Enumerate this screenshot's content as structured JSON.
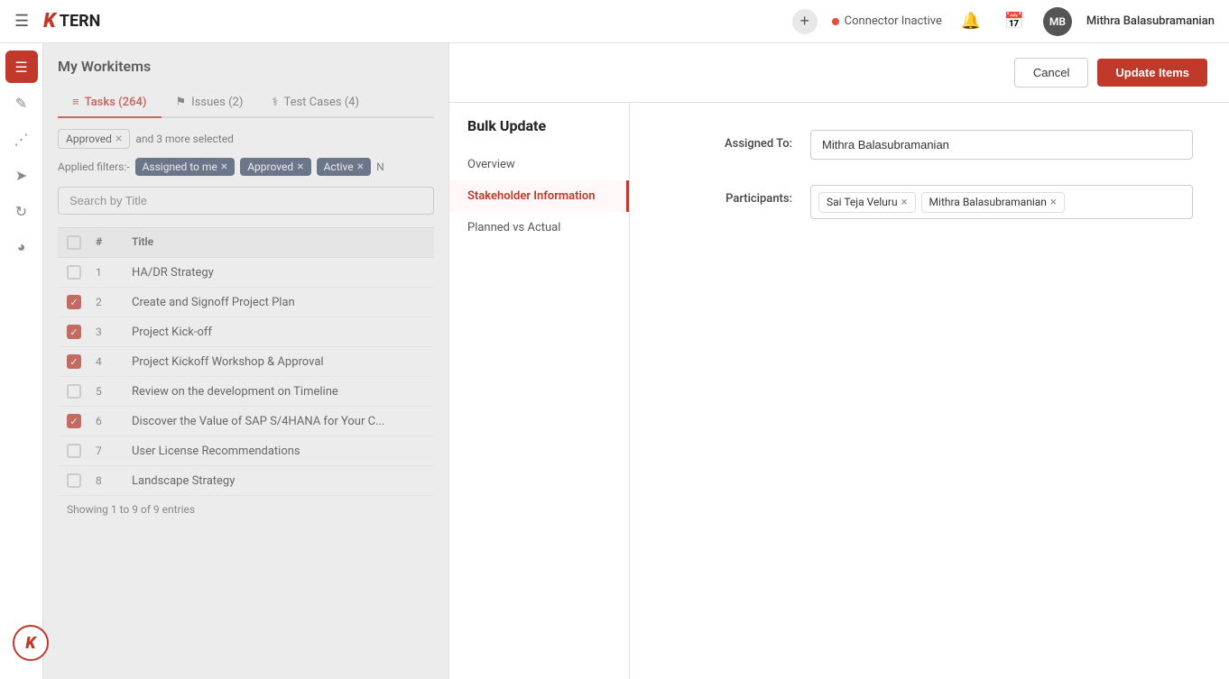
{
  "app": {
    "logo_k": "K",
    "logo_tern": "TERN"
  },
  "nav": {
    "connector_label": "Connector Inactive",
    "username": "Mithra Balasubramanian",
    "avatar_initials": "MB",
    "add_btn_label": "+"
  },
  "workitems": {
    "title": "My Workitems",
    "tabs": [
      {
        "id": "tasks",
        "icon": "≡",
        "label": "Tasks (264)",
        "active": true
      },
      {
        "id": "issues",
        "icon": "⚑",
        "label": "Issues (2)",
        "active": false
      },
      {
        "id": "testcases",
        "icon": "⚗",
        "label": "Test Cases (4)",
        "active": false
      }
    ],
    "selected_badges": [
      {
        "label": "Approved",
        "removable": true
      }
    ],
    "more_selected": "and 3 more selected",
    "filters_label": "Applied filters:-",
    "filters": [
      {
        "label": "Assigned to me",
        "removable": true
      },
      {
        "label": "Approved",
        "removable": true
      },
      {
        "label": "Active",
        "removable": true
      },
      {
        "label": "N",
        "removable": false
      }
    ],
    "search_placeholder": "Search by Title",
    "table_columns": [
      "#",
      "Title"
    ],
    "rows": [
      {
        "num": 1,
        "title": "HA/DR Strategy",
        "checked": false
      },
      {
        "num": 2,
        "title": "Create and Signoff Project Plan",
        "checked": true
      },
      {
        "num": 3,
        "title": "Project Kick-off",
        "checked": true
      },
      {
        "num": 4,
        "title": "Project Kickoff Workshop & Approval",
        "checked": true
      },
      {
        "num": 5,
        "title": "Review on the development on Timeline",
        "checked": false
      },
      {
        "num": 6,
        "title": "Discover the Value of SAP S/4HANA for Your C...",
        "checked": true
      },
      {
        "num": 7,
        "title": "User License Recommendations",
        "checked": false
      },
      {
        "num": 8,
        "title": "Landscape Strategy",
        "checked": false
      }
    ],
    "footer": "Showing 1 to 9 of 9 entries"
  },
  "bulk_update": {
    "title": "Bulk Update",
    "cancel_label": "Cancel",
    "update_label": "Update Items",
    "nav_items": [
      {
        "id": "overview",
        "label": "Overview",
        "active": false
      },
      {
        "id": "stakeholder",
        "label": "Stakeholder Information",
        "active": true
      },
      {
        "id": "planned",
        "label": "Planned vs Actual",
        "active": false
      }
    ],
    "form": {
      "assigned_to_label": "Assigned To:",
      "assigned_to_value": "Mithra Balasubramanian",
      "participants_label": "Participants:",
      "participants": [
        {
          "name": "Sai Teja Veluru"
        },
        {
          "name": "Mithra Balasubramanian"
        }
      ]
    }
  }
}
